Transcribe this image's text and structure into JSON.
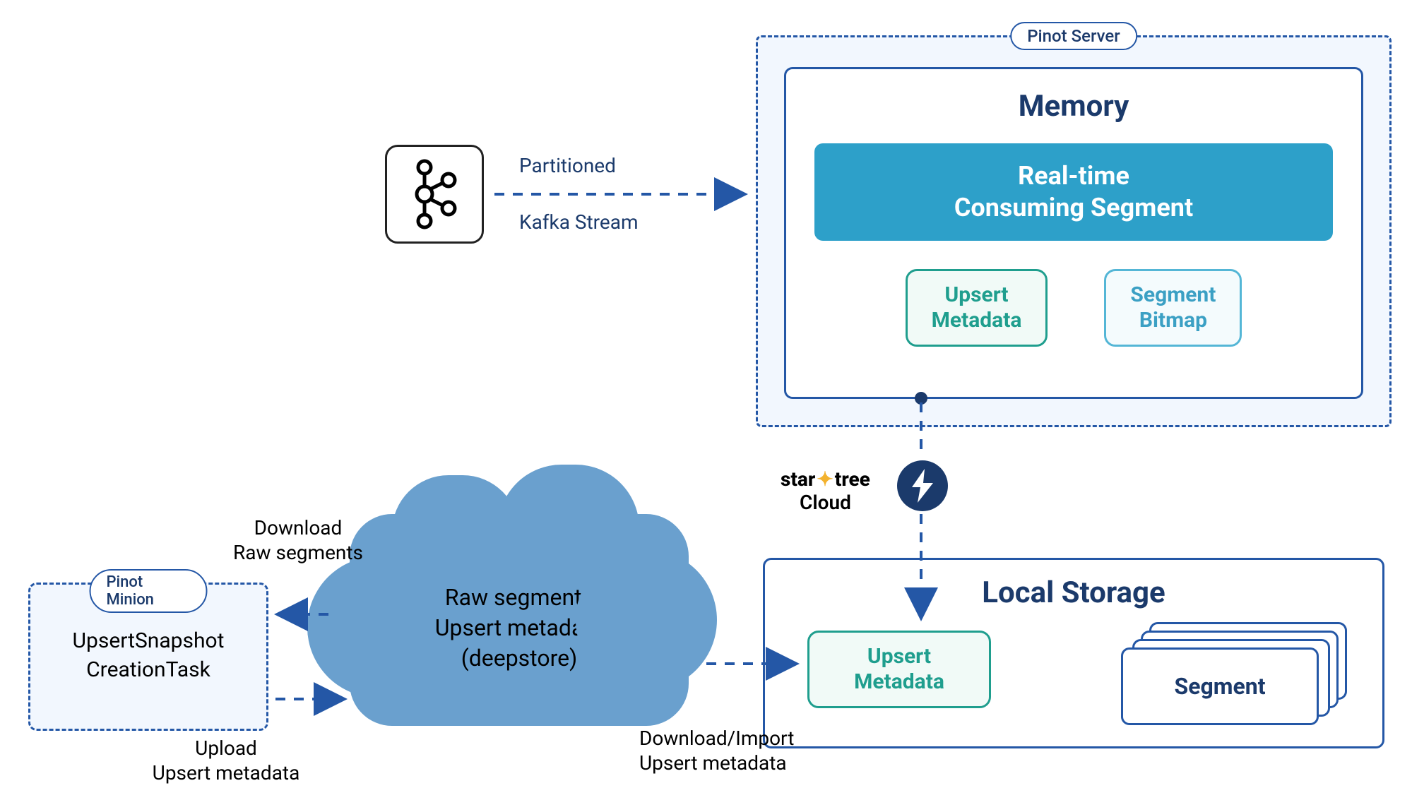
{
  "domain": "Diagram",
  "pinot_server": {
    "label": "Pinot Server"
  },
  "memory": {
    "title": "Memory",
    "realtime_line1": "Real-time",
    "realtime_line2": "Consuming Segment",
    "upsert_meta_line1": "Upsert",
    "upsert_meta_line2": "Metadata",
    "segment_bitmap_line1": "Segment",
    "segment_bitmap_line2": "Bitmap"
  },
  "kafka": {
    "top_label": "Partitioned",
    "bottom_label": "Kafka Stream"
  },
  "startree": {
    "brand_star": "star",
    "brand_tree": "tree",
    "cloud": "Cloud"
  },
  "local_storage": {
    "title": "Local Storage",
    "upsert_meta_line1": "Upsert",
    "upsert_meta_line2": "Metadata",
    "segment": "Segment"
  },
  "deepstore": {
    "line1": "Raw segments",
    "line2": "Upsert metadata",
    "line3": "(deepstore)"
  },
  "minion": {
    "label": "Pinot Minion",
    "task_line1": "UpsertSnapshot",
    "task_line2": "CreationTask"
  },
  "labels": {
    "download_line1": "Download",
    "download_line2": "Raw segments",
    "upload_line1": "Upload",
    "upload_line2": "Upsert metadata",
    "dlimport_line1": "Download/Import",
    "dlimport_line2": "Upsert metadata"
  },
  "colors": {
    "primary": "#2457a6",
    "navy": "#1b3a6b",
    "teal": "#1f9e8e",
    "sky": "#54b6d6",
    "cyan_fill": "#2da0c9",
    "cloud_fill": "#6aa0ce",
    "tint_bg": "#f2f7fe",
    "accent_yellow": "#f3b22e"
  }
}
